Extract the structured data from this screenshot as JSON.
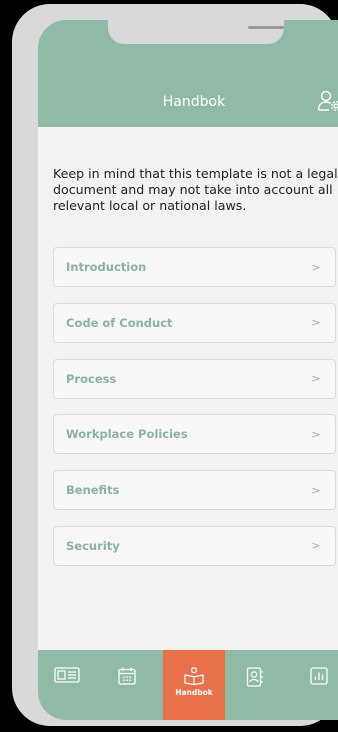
{
  "colors": {
    "primary": "#8ebaa6",
    "accent": "#e8714a",
    "item_text": "#8ab3a1",
    "background": "#f3f2f0"
  },
  "header": {
    "title": "Handbok",
    "right_icon": "user-settings-icon"
  },
  "intro_text": "Keep in mind that this template is not a legal document and may not take into account all relevant local or national laws.",
  "sections": [
    {
      "label": "Introduction"
    },
    {
      "label": "Code of Conduct"
    },
    {
      "label": "Process"
    },
    {
      "label": "Workplace Policies"
    },
    {
      "label": "Benefits"
    },
    {
      "label": "Security"
    }
  ],
  "tabbar": {
    "tabs": [
      {
        "icon": "id-card-icon",
        "label": ""
      },
      {
        "icon": "calendar-icon",
        "label": ""
      },
      {
        "icon": "handbook-icon",
        "label": "Handbok",
        "active": true
      },
      {
        "icon": "contacts-icon",
        "label": ""
      },
      {
        "icon": "chart-icon",
        "label": ""
      }
    ]
  }
}
